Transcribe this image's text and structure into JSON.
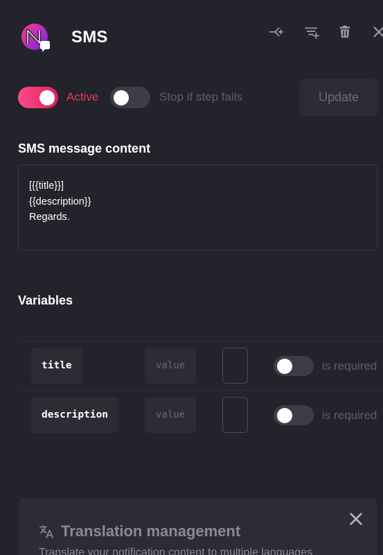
{
  "header": {
    "title": "SMS",
    "icons": [
      "branch-add-icon",
      "filter-add-icon",
      "trash-icon",
      "close-icon"
    ],
    "brand_colors": {
      "accent": "#e9385a",
      "gradient_start": "#ff4d8a",
      "gradient_end": "#e01e5a"
    }
  },
  "controls": {
    "active_label": "Active",
    "active_on": true,
    "stop_label": "Stop if step fails",
    "stop_on": false,
    "update_label": "Update"
  },
  "content": {
    "heading": "SMS message content",
    "message": "[{{title}}]\n{{description}}\nRegards."
  },
  "variables": {
    "heading": "Variables",
    "rows": [
      {
        "name": "title",
        "value_placeholder": "value",
        "required_label": "is required",
        "required": false
      },
      {
        "name": "description",
        "value_placeholder": "value",
        "required_label": "is required",
        "required": false
      }
    ]
  },
  "translation": {
    "title": "Translation management",
    "description": "Translate your notification content to multiple languages",
    "icon": "translate-icon"
  }
}
